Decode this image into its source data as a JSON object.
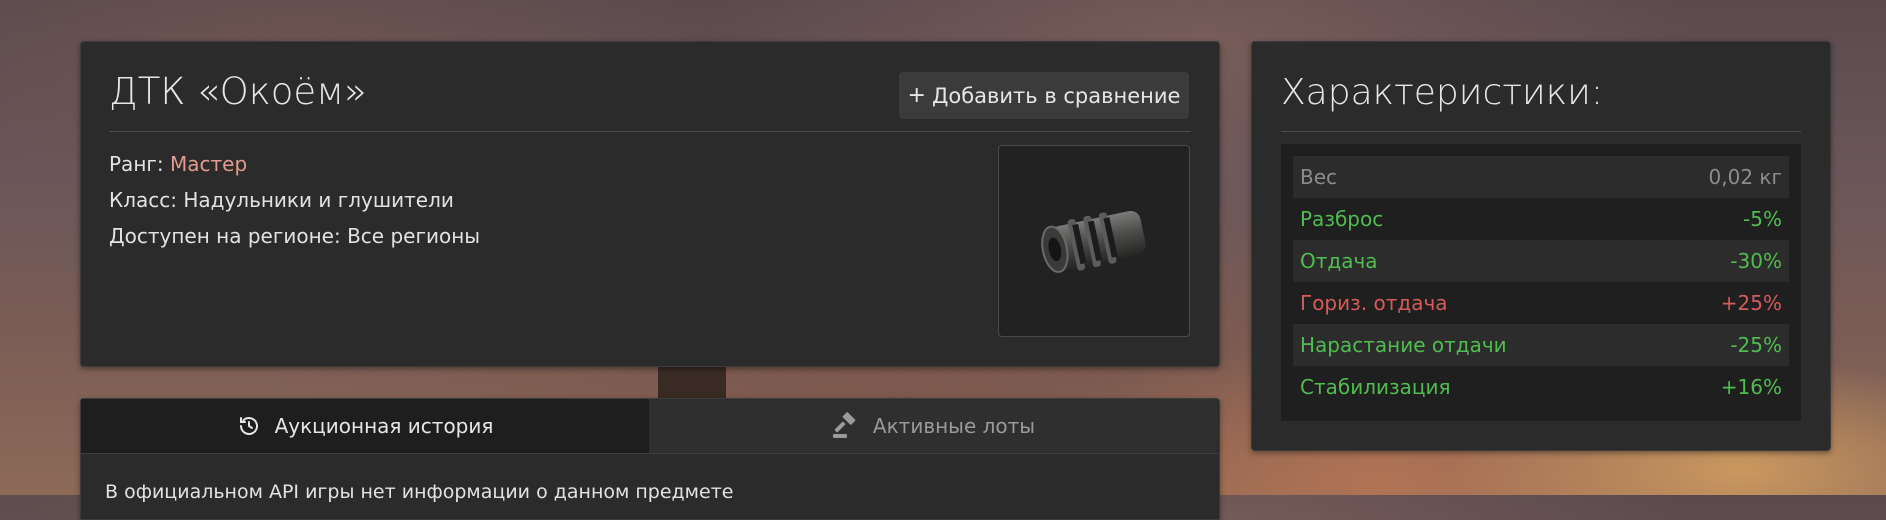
{
  "item": {
    "title": "ДТК «Окоём»",
    "compare_button": "Добавить в сравнение",
    "rank_label": "Ранг:",
    "rank_value": "Мастер",
    "class_line": "Класс: Надульники и глушители",
    "region_line": "Доступен на регионе: Все регионы",
    "image_icon": "muzzle-brake-image",
    "colors": {
      "rank": "#e49a8f",
      "panel": "#2b2b2b"
    }
  },
  "tabs": {
    "history_label": "Аукционная история",
    "history_icon": "history-icon",
    "lots_label": "Активные лоты",
    "lots_icon": "gavel-icon",
    "note": "В официальном API игры нет информации о данном предмете"
  },
  "stats": {
    "title": "Характеристики:",
    "rows": [
      {
        "label": "Вес",
        "value": "0,02 кг",
        "tone": "muted"
      },
      {
        "label": "Разброс",
        "value": "-5%",
        "tone": "good"
      },
      {
        "label": "Отдача",
        "value": "-30%",
        "tone": "good"
      },
      {
        "label": "Гориз. отдача",
        "value": "+25%",
        "tone": "bad"
      },
      {
        "label": "Нарастание отдачи",
        "value": "-25%",
        "tone": "good"
      },
      {
        "label": "Стабилизация",
        "value": "+16%",
        "tone": "good"
      }
    ],
    "colors": {
      "good": "#4fbd4f",
      "bad": "#d75a5a",
      "muted": "#8c8c8c"
    }
  }
}
